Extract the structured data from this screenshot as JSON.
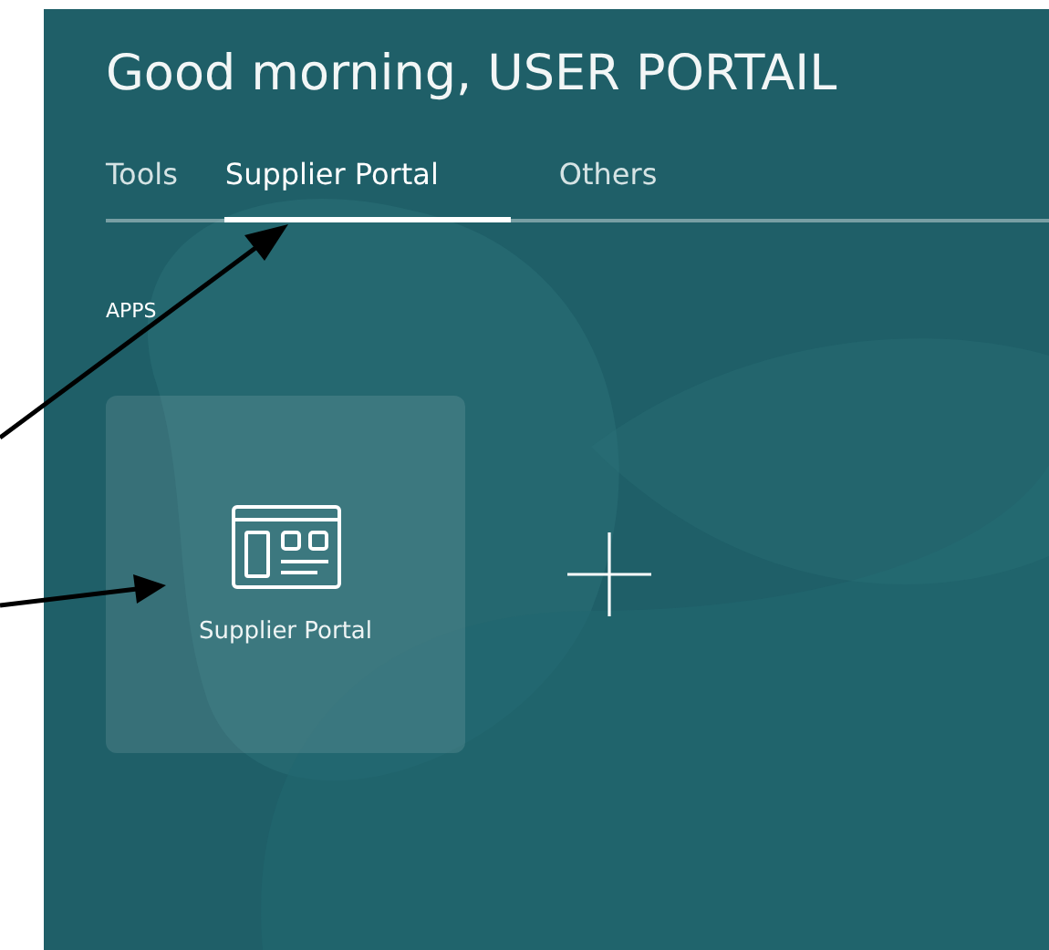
{
  "greeting": "Good morning, USER PORTAIL",
  "tabs": [
    {
      "label": "Tools",
      "selected": false
    },
    {
      "label": "Supplier Portal",
      "selected": true
    },
    {
      "label": "Others",
      "selected": false
    }
  ],
  "section_label": "APPS",
  "apps": [
    {
      "kind": "app",
      "label": "Supplier Portal"
    },
    {
      "kind": "add"
    }
  ]
}
